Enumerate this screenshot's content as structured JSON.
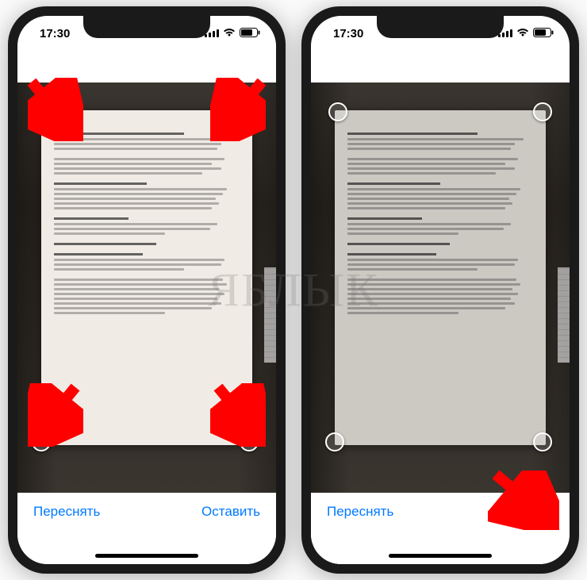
{
  "status": {
    "time": "17:30"
  },
  "buttons": {
    "retake": "Переснять",
    "keep": "Оставить"
  },
  "watermark": "ЯБЛЫК",
  "icons": {
    "signal": "signal-icon",
    "wifi": "wifi-icon",
    "battery": "battery-icon"
  },
  "colors": {
    "accent": "#007aff",
    "arrow": "#ff0000"
  }
}
